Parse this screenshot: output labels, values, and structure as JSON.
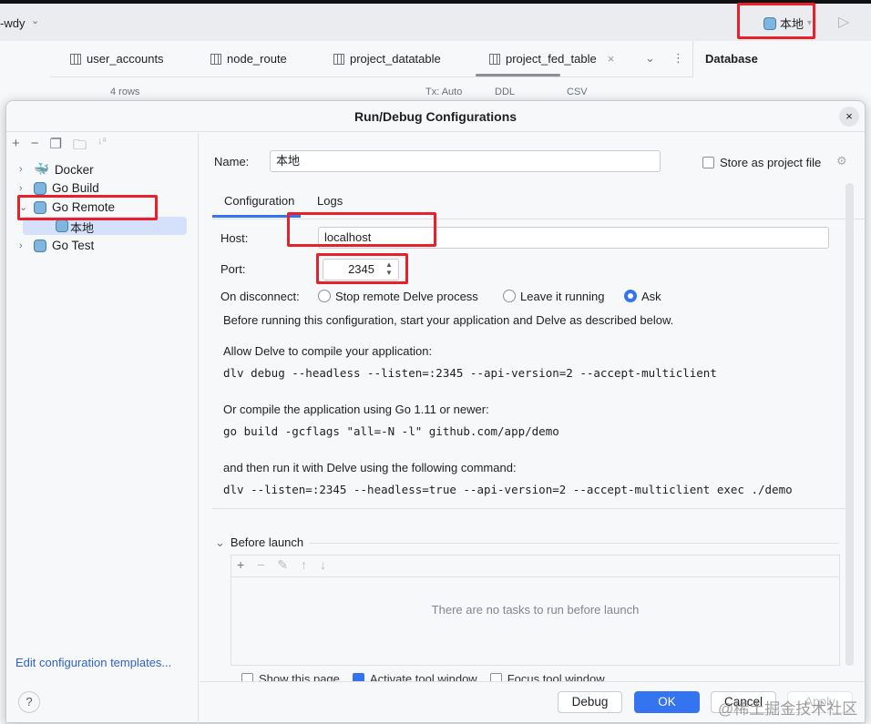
{
  "header": {
    "project": "-wdy",
    "run_config": "本地"
  },
  "editor_tabs": [
    "user_accounts",
    "node_route",
    "project_datatable",
    "project_fed_table"
  ],
  "database_panel": {
    "title": "Database"
  },
  "toolbar": {
    "rows": "4 rows",
    "tx": "Tx: Auto",
    "ddl": "DDL",
    "csv": "CSV"
  },
  "dialog": {
    "title": "Run/Debug Configurations",
    "tree": [
      {
        "label": "Docker",
        "expanded": false
      },
      {
        "label": "Go Build",
        "expanded": false
      },
      {
        "label": "Go Remote",
        "expanded": true
      },
      {
        "label": "本地",
        "child": true,
        "selected": true
      },
      {
        "label": "Go Test",
        "expanded": false
      }
    ],
    "edit_templates": "Edit configuration templates...",
    "name_label": "Name:",
    "name_value": "本地",
    "store_label": "Store as project file",
    "tabs": [
      "Configuration",
      "Logs"
    ],
    "host_label": "Host:",
    "host_value": "localhost",
    "port_label": "Port:",
    "port_value": "2345",
    "disconnect_label": "On disconnect:",
    "disconnect_options": [
      "Stop remote Delve process",
      "Leave it running",
      "Ask"
    ],
    "disconnect_selected": "Ask",
    "help": [
      "Before running this configuration, start your application and Delve as described below.",
      "Allow Delve to compile your application:",
      "dlv debug --headless --listen=:2345 --api-version=2 --accept-multiclient",
      "Or compile the application using Go 1.11 or newer:",
      "go build -gcflags \"all=-N -l\" github.com/app/demo",
      "and then run it with Delve using the following command:",
      "dlv --listen=:2345 --headless=true --api-version=2 --accept-multiclient exec ./demo"
    ],
    "before_launch": "Before launch",
    "no_tasks": "There are no tasks to run before launch",
    "checkboxes": [
      {
        "label": "Show this page",
        "checked": false
      },
      {
        "label": "Activate tool window",
        "checked": true
      },
      {
        "label": "Focus tool window",
        "checked": false
      }
    ],
    "buttons": {
      "debug": "Debug",
      "ok": "OK",
      "cancel": "Cancel",
      "apply": "Apply"
    }
  },
  "watermark": "@稀土掘金技术社区"
}
